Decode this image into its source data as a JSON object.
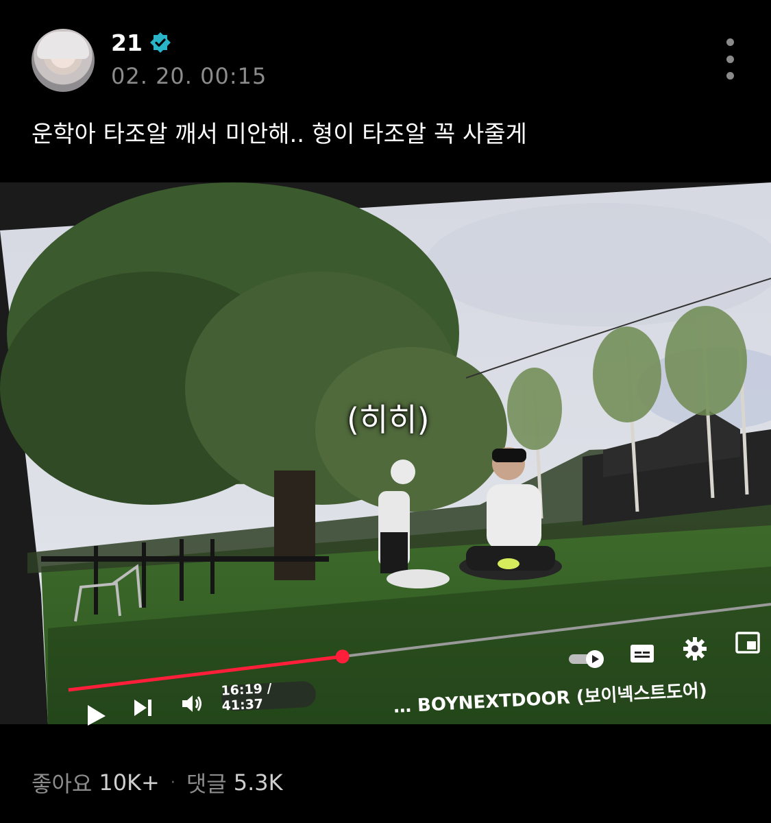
{
  "post": {
    "author": "21",
    "timestamp": "02. 20. 00:15",
    "text": "운학아 타조알 깨서 미안해.. 형이 타조알 꼭 사줄게"
  },
  "video": {
    "subtitle": "(히히)",
    "current_time": "16:19 / 41:37",
    "progress": 0.39,
    "channel": "… BOYNEXTDOOR (보이넥스트도어)"
  },
  "stats": {
    "likes_label": "좋아요",
    "likes_value": "10K+",
    "separator": "·",
    "comments_label": "댓글",
    "comments_value": "5.3K"
  },
  "colors": {
    "verified": "#2ab4c8",
    "progress": "#ff1f3a",
    "muted_text": "#8c8c8c"
  },
  "icons": [
    "verified-badge-icon",
    "more-vertical-icon",
    "play-icon",
    "next-icon",
    "volume-icon",
    "autoplay-toggle-icon",
    "captions-icon",
    "settings-gear-icon",
    "miniplayer-icon"
  ]
}
